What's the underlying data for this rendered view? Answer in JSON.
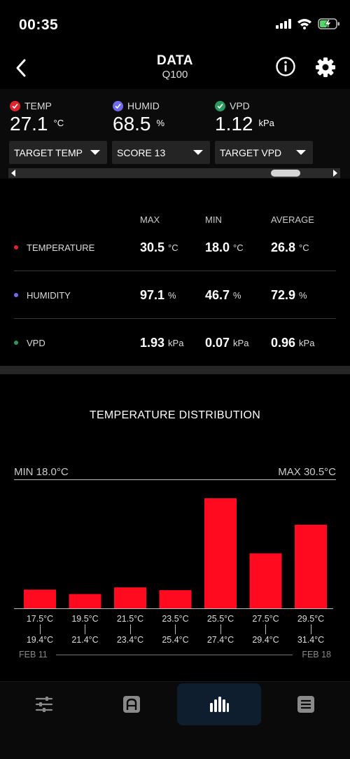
{
  "status_bar": {
    "time": "00:35"
  },
  "header": {
    "title": "DATA",
    "subtitle": "Q100"
  },
  "readings": [
    {
      "label": "TEMP",
      "value": "27.1",
      "unit": "°C",
      "check_color": "#e0242e"
    },
    {
      "label": "HUMID",
      "value": "68.5",
      "unit": "%",
      "check_color": "#6f6bea"
    },
    {
      "label": "VPD",
      "value": "1.12",
      "unit": "kPa",
      "check_color": "#2a9a5e"
    }
  ],
  "dropdowns": [
    "TARGET TEMP",
    "SCORE 13",
    "TARGET VPD"
  ],
  "scroll_position": 0.88,
  "stats": {
    "headers": {
      "max": "MAX",
      "min": "MIN",
      "avg": "AVERAGE"
    },
    "rows": [
      {
        "name": "TEMPERATURE",
        "dot_color": "#e0242e",
        "max": "30.5",
        "min": "18.0",
        "avg": "26.8",
        "unit": "°C"
      },
      {
        "name": "HUMIDITY",
        "dot_color": "#6f6bea",
        "max": "97.1",
        "min": "46.7",
        "avg": "72.9",
        "unit": "%"
      },
      {
        "name": "VPD",
        "dot_color": "#2a9a5e",
        "max": "1.93",
        "min": "0.07",
        "avg": "0.96",
        "unit": "kPa"
      }
    ]
  },
  "distribution": {
    "title": "TEMPERATURE DISTRIBUTION",
    "min_label": "MIN 18.0°C",
    "max_label": "MAX 30.5°C",
    "date_start": "FEB 11",
    "date_end": "FEB 18"
  },
  "chart_data": {
    "type": "bar",
    "title": "TEMPERATURE DISTRIBUTION",
    "bar_color": "#ff0a1e",
    "categories": [
      {
        "low": "17.5°C",
        "high": "19.4°C"
      },
      {
        "low": "19.5°C",
        "high": "21.4°C"
      },
      {
        "low": "21.5°C",
        "high": "23.4°C"
      },
      {
        "low": "23.5°C",
        "high": "25.4°C"
      },
      {
        "low": "25.5°C",
        "high": "27.4°C"
      },
      {
        "low": "27.5°C",
        "high": "29.4°C"
      },
      {
        "low": "29.5°C",
        "high": "31.4°C"
      }
    ],
    "values": [
      0.17,
      0.13,
      0.19,
      0.165,
      1.0,
      0.5,
      0.76
    ],
    "ylim": [
      0,
      1
    ],
    "grid": false
  },
  "tabs": [
    {
      "name": "controls",
      "icon": "sliders-icon",
      "active": false
    },
    {
      "name": "device",
      "icon": "device-icon",
      "active": false
    },
    {
      "name": "data",
      "icon": "bar-chart-icon",
      "active": true
    },
    {
      "name": "log",
      "icon": "list-icon",
      "active": false
    }
  ]
}
